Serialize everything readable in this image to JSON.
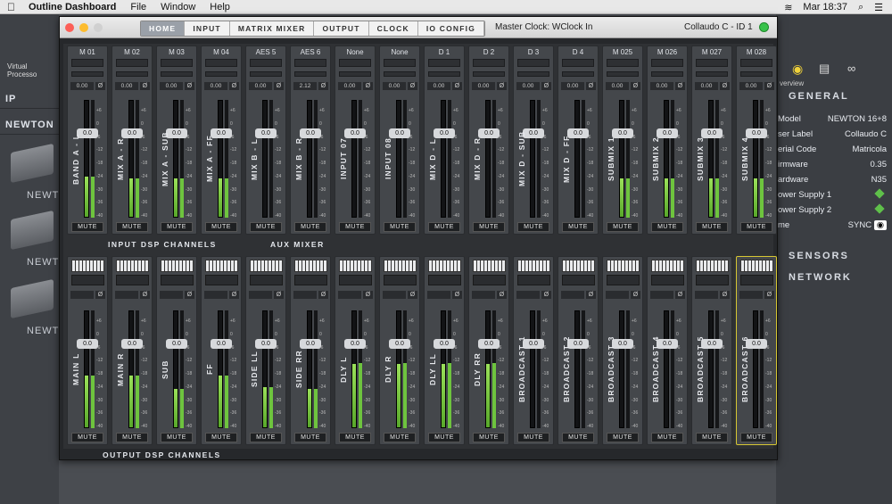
{
  "menubar": {
    "app": "Outline Dashboard",
    "items": [
      "File",
      "Window",
      "Help"
    ],
    "clock": "Mar 18:37"
  },
  "window": {
    "tabs": [
      "HOME",
      "INPUT",
      "MATRIX MIXER",
      "OUTPUT",
      "CLOCK",
      "IO CONFIG"
    ],
    "active_tab": "HOME",
    "master_clock": "Master Clock: WClock In",
    "device": "Collaudo C - ID 1"
  },
  "bg_left": {
    "ip": "IP",
    "newton": "NEWTON",
    "virtual": "Virtual Processo",
    "devices": [
      "NEWT",
      "NEWT",
      "NEWT"
    ]
  },
  "bg_right": {
    "overview": "verview",
    "general": "GENERAL",
    "rows": [
      [
        "Model",
        "NEWTON 16+8"
      ],
      [
        "ser Label",
        "Collaudo C"
      ],
      [
        "erial Code",
        "Matricola"
      ],
      [
        "irmware",
        "0.35"
      ],
      [
        "ardware",
        "N35"
      ],
      [
        "ower Supply 1",
        ""
      ],
      [
        "ower Supply 2",
        ""
      ],
      [
        "me",
        "SYNC"
      ]
    ],
    "sensors": "SENSORS",
    "network": "NETWORK"
  },
  "input_section": {
    "label_a": "INPUT DSP CHANNELS",
    "label_b": "AUX MIXER",
    "channels": [
      {
        "src": "M 01",
        "gain": "0.00",
        "name": "BAND A - L",
        "level": 0.35
      },
      {
        "src": "M 02",
        "gain": "0.00",
        "name": "MIX A - R",
        "level": 0.33
      },
      {
        "src": "M 03",
        "gain": "0.00",
        "name": "MIX A - SUB",
        "level": 0.33
      },
      {
        "src": "M 04",
        "gain": "0.00",
        "name": "MIX A - FF",
        "level": 0.33
      },
      {
        "src": "AES 5",
        "gain": "0.00",
        "name": "MIX B - L",
        "level": 0.0
      },
      {
        "src": "AES 6",
        "gain": "2.12",
        "name": "MIX B - R",
        "level": 0.0
      },
      {
        "src": "None",
        "gain": "0.00",
        "name": "INPUT 07",
        "level": 0.0
      },
      {
        "src": "None",
        "gain": "0.00",
        "name": "INPUT 08",
        "level": 0.0
      },
      {
        "src": "D 1",
        "gain": "0.00",
        "name": "MIX D - L",
        "level": 0.0
      },
      {
        "src": "D 2",
        "gain": "0.00",
        "name": "MIX D - R",
        "level": 0.0
      },
      {
        "src": "D 3",
        "gain": "0.00",
        "name": "MIX D - SUB",
        "level": 0.0
      },
      {
        "src": "D 4",
        "gain": "0.00",
        "name": "MIX D - FF",
        "level": 0.0
      },
      {
        "src": "M 025",
        "gain": "0.00",
        "name": "SUBMIX 1",
        "level": 0.33
      },
      {
        "src": "M 026",
        "gain": "0.00",
        "name": "SUBMIX 2",
        "level": 0.33
      },
      {
        "src": "M 027",
        "gain": "0.00",
        "name": "SUBMIX 3",
        "level": 0.33
      },
      {
        "src": "M 028",
        "gain": "0.00",
        "name": "SUBMIX 4",
        "level": 0.33
      }
    ]
  },
  "output_section": {
    "label": "OUTPUT DSP CHANNELS",
    "channels": [
      {
        "name": "MAIN L",
        "level": 0.45
      },
      {
        "name": "MAIN R",
        "level": 0.45
      },
      {
        "name": "SUB",
        "level": 0.33
      },
      {
        "name": "FF",
        "level": 0.45
      },
      {
        "name": "SIDE LL",
        "level": 0.35
      },
      {
        "name": "SIDE RR",
        "level": 0.33
      },
      {
        "name": "DLY L",
        "level": 0.55
      },
      {
        "name": "DLY R",
        "level": 0.55
      },
      {
        "name": "DLY LL",
        "level": 0.55
      },
      {
        "name": "DLY RR",
        "level": 0.55
      },
      {
        "name": "BROADCAST 1",
        "level": 0.0
      },
      {
        "name": "BROADCAST 2",
        "level": 0.0
      },
      {
        "name": "BROADCAST 3",
        "level": 0.0
      },
      {
        "name": "BROADCAST 4",
        "level": 0.0
      },
      {
        "name": "BROADCAST 5",
        "level": 0.0
      },
      {
        "name": "BROADCAST 6",
        "level": 0.0
      }
    ]
  },
  "common": {
    "knob": "0.0",
    "mute": "MUTE",
    "phase": "Ø",
    "ticks": [
      "+6",
      "0",
      "-6",
      "-12",
      "-18",
      "-24",
      "-30",
      "-36",
      "-40"
    ]
  }
}
